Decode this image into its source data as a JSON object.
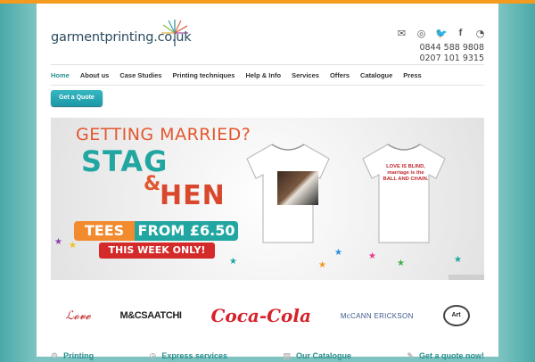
{
  "site": {
    "logo_text": "garmentprinting.co.uk"
  },
  "social": [
    "mail-icon",
    "dribbble-icon",
    "twitter-icon",
    "facebook-icon",
    "rss-icon"
  ],
  "phones": [
    "0844 588 9808",
    "0207 101 9315"
  ],
  "nav": [
    "Home",
    "About us",
    "Case Studies",
    "Printing techniques",
    "Help & Info",
    "Services",
    "Offers",
    "Catalogue",
    "Press"
  ],
  "quote_button": "Get a Quote",
  "banner": {
    "headline": "GETTING MARRIED?",
    "stag": "STAG",
    "amp": "&",
    "hen": "HEN",
    "tees": "TEES",
    "price": "FROM £6.50",
    "promo": "THIS WEEK ONLY!",
    "shirt_text": "LOVE IS BLIND, marriage is the BALL AND CHAIN."
  },
  "clients": [
    "Artwork Logo",
    "M&CSAATCHI",
    "Coca-Cola",
    "McCANN ERICKSON",
    "Art"
  ],
  "footer": [
    "Printing",
    "Express services",
    "Our Catalogue",
    "Get a quote now!"
  ],
  "colors": {
    "accent": "#2a8f8d",
    "orange": "#f39a1f",
    "button": "#1c98a6"
  }
}
